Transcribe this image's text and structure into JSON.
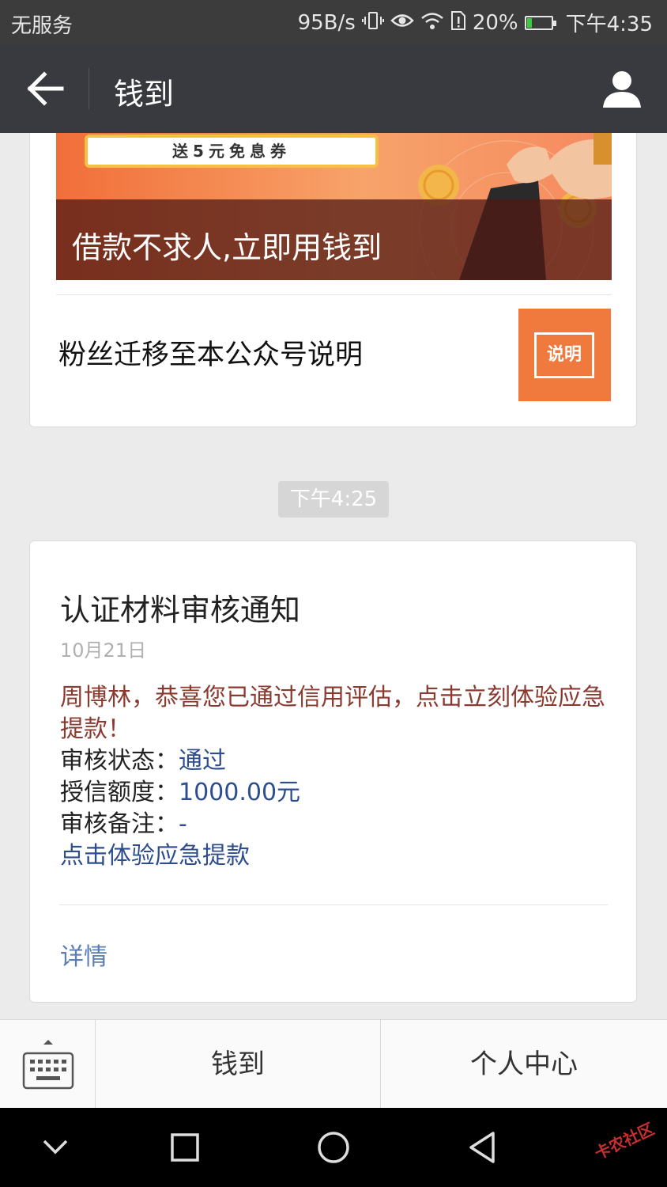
{
  "status_bar": {
    "carrier": "无服务",
    "net_speed": "95B/s",
    "battery_percent": "20%",
    "battery_level": 0.2,
    "time": "下午4:35"
  },
  "title_bar": {
    "title": "钱到"
  },
  "banner": {
    "coupon_text": "送5元免息券",
    "caption": "借款不求人,立即用钱到"
  },
  "article": {
    "title": "粉丝迁移至本公众号说明",
    "thumb_label": "说明"
  },
  "timestamp": "下午4:25",
  "message": {
    "title": "认证材料审核通知",
    "date": "10月21日",
    "lead": "周博林，恭喜您已通过信用评估，点击立刻体验应急提款！",
    "status_label": "审核状态：",
    "status_value": "通过",
    "credit_label": "授信额度：",
    "credit_value": "1000.00元",
    "remark_label": "审核备注：",
    "remark_value": "-",
    "link_text": "点击体验应急提款",
    "detail_label": "详情"
  },
  "bottom_menu": {
    "items": [
      {
        "label": "钱到"
      },
      {
        "label": "个人中心"
      }
    ]
  },
  "watermark": "卡农社区",
  "colors": {
    "title_bar": "#393a3f",
    "link": "#2e4d8f",
    "lead_text": "#8b3a2f",
    "thumb": "#f0793e"
  }
}
